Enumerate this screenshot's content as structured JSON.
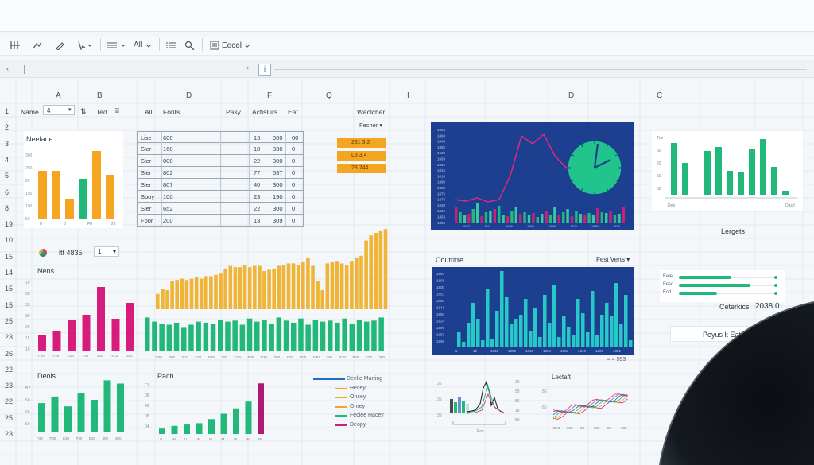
{
  "toolbar": {
    "tool_icons": [
      "grid-icon",
      "draw-icon",
      "pen-icon",
      "cursor-icon"
    ],
    "lines_icon": "lines-icon",
    "font_value": "AlI",
    "list_icon": "list-icon",
    "search_icon": "search-icon",
    "app_label": "Eecel"
  },
  "formula_bar": {
    "fx_label": "i"
  },
  "columns": {
    "a": "A",
    "b": "B",
    "d": "D",
    "f": "F",
    "q": "Q",
    "i": "I",
    "d2": "D",
    "c": "C"
  },
  "rows": [
    "1",
    "2",
    "3",
    "4",
    "5",
    "6",
    "8",
    "19",
    "10",
    "15",
    "14",
    "15",
    "15",
    "25",
    "23",
    "26",
    "22",
    "23",
    "22",
    "25",
    "23"
  ],
  "header_row": {
    "name": "Name",
    "name_val": "4",
    "ted": "Ted",
    "all": "All",
    "fonts": "Fonts",
    "pasy": "Pasy",
    "actions": "Actislurs",
    "eat": "Eat",
    "weather": "Weclcher",
    "fecher": "Fecher"
  },
  "top_left_chart": {
    "title": "Neelane",
    "bars": [
      60,
      60,
      25,
      50,
      85,
      55
    ],
    "colors": [
      "#f4a623",
      "#f4a623",
      "#f4a623",
      "#21b879",
      "#f4a623",
      "#f4a623"
    ],
    "ticks": [
      "8",
      "0",
      "F8",
      "28"
    ]
  },
  "table": {
    "rows": [
      [
        "Lise",
        "600",
        "13",
        "900",
        "00"
      ],
      [
        "Sier",
        "160",
        "18",
        "330",
        "0"
      ],
      [
        "Sier",
        "000",
        "22",
        "300",
        "0"
      ],
      [
        "Sier",
        "802",
        "77",
        "537",
        "0"
      ],
      [
        "Sier",
        "807",
        "40",
        "300",
        "0"
      ],
      [
        "Sboy",
        "100",
        "23",
        "190",
        "0"
      ],
      [
        "Sier",
        "652",
        "22",
        "300",
        "0"
      ],
      [
        "Foor",
        "200",
        "13",
        "309",
        "0"
      ]
    ]
  },
  "tags": [
    "231 3.2",
    "L8 3.4",
    "23 744"
  ],
  "blue_top_chart": {
    "line": [
      30,
      28,
      32,
      27,
      30,
      60,
      110,
      100,
      112,
      85,
      70,
      80,
      75
    ],
    "bars": [
      20,
      14,
      10,
      12,
      18,
      25,
      9,
      14,
      15,
      18,
      22,
      10,
      9,
      16,
      20,
      12,
      14,
      10,
      13,
      8,
      12,
      15,
      10,
      20,
      11,
      14,
      18,
      9,
      15,
      12,
      10,
      13,
      11,
      19,
      14,
      13,
      16,
      10,
      12,
      20
    ],
    "ylabels": [
      "1863",
      "1860",
      "1848",
      "1885",
      "1633",
      "1683",
      "1832",
      "1815",
      "1815",
      "1860",
      "1888",
      "1875",
      "1873",
      "1830",
      "1865",
      "1853",
      "1889"
    ],
    "xlabels": [
      "1832",
      "1821",
      "1888",
      "1896",
      "1898",
      "1825",
      "1880",
      "1875"
    ]
  },
  "right_small_chart": {
    "ylabels": [
      "Tus",
      "50",
      "20",
      "50",
      "50"
    ],
    "xlabels": [
      "Deb",
      "Dasd"
    ],
    "bars": [
      65,
      40,
      0,
      55,
      60,
      30,
      28,
      58,
      70,
      35,
      5
    ],
    "label": "Lergets"
  },
  "widget": {
    "icon": "chrome-like-icon",
    "value": "ltt 4835",
    "dropdown": "1"
  },
  "pink_chart": {
    "title": "Nens",
    "bars": [
      20,
      25,
      38,
      45,
      80,
      40,
      60
    ],
    "ticks": [
      "F20",
      "F30",
      "E20",
      "F38",
      "300",
      "FL0",
      "300"
    ]
  },
  "middle_chart": {
    "orange_bars": [
      12,
      16,
      15,
      22,
      23,
      24,
      23,
      24,
      25,
      24,
      26,
      26,
      27,
      28,
      32,
      34,
      33,
      33,
      35,
      33,
      34,
      34,
      30,
      31,
      32,
      34,
      35,
      36,
      36,
      35,
      37,
      40,
      34,
      22,
      15,
      36,
      37,
      38,
      36,
      35,
      38,
      40,
      42,
      54,
      58,
      60,
      62,
      63
    ],
    "green_bars": [
      32,
      28,
      26,
      25,
      27,
      22,
      25,
      28,
      27,
      26,
      30,
      28,
      29,
      25,
      31,
      28,
      30,
      26,
      32,
      29,
      27,
      31,
      25,
      30,
      28,
      29,
      27,
      31,
      26,
      30,
      28,
      29,
      32
    ],
    "ticks": [
      "F30",
      "300",
      "E10",
      "F30",
      "F30",
      "300",
      "E30",
      "F30",
      "F30",
      "300",
      "E20",
      "F30",
      "F30",
      "300",
      "E30",
      "F30",
      "F30",
      "300"
    ]
  },
  "countries": {
    "title": "Coutrirre",
    "dropdown": "Fest Verts",
    "bars": [
      18,
      6,
      30,
      55,
      35,
      8,
      72,
      10,
      45,
      95,
      62,
      28,
      35,
      40,
      60,
      20,
      48,
      12,
      65,
      30,
      78,
      12,
      38,
      25,
      15,
      60,
      42,
      18,
      70,
      15,
      40,
      55,
      38,
      80,
      28,
      65,
      8
    ],
    "ylabels": [
      "1860",
      "1866",
      "1800",
      "1853",
      "1850",
      "1843",
      "1850",
      "1824",
      "1896",
      "1850",
      "1895"
    ],
    "xlabels": [
      "5",
      "12",
      "1830",
      "1800",
      "1810",
      "1804",
      "1883",
      "1810",
      "1300",
      "1301"
    ],
    "footer": "≈ ≈ 593"
  },
  "progress": {
    "items": [
      {
        "label": "Eeie",
        "value": 0.55
      },
      {
        "label": "Fesd",
        "value": 0.75
      },
      {
        "label": "Fod",
        "value": 0.4
      }
    ],
    "footer_label": "Ceterkics",
    "footer_value": "2038.0",
    "link": "Peyus k Eat"
  },
  "dools_chart": {
    "title": "Deols",
    "bars": [
      45,
      55,
      40,
      60,
      50,
      80,
      75
    ],
    "ticks": [
      "F30",
      "F30",
      "E30",
      "F30",
      "E30",
      "300",
      "300"
    ],
    "ylabels": [
      "B2",
      "50",
      "60",
      "50"
    ]
  },
  "path_chart": {
    "title": "Pach",
    "bars": [
      8,
      12,
      14,
      16,
      22,
      30,
      38,
      48,
      75
    ],
    "ticks": [
      "V",
      "W",
      "V",
      "W",
      "M",
      "M",
      "W",
      "W",
      "W"
    ],
    "ylabels": [
      "C8",
      "08",
      "48",
      "08",
      "04"
    ]
  },
  "legend": {
    "items": [
      {
        "label": "Deelie Marting",
        "color": "#1a6fbf"
      },
      {
        "label": "Hecey",
        "color": "#f4a623"
      },
      {
        "label": "Onsey",
        "color": "#f4a623"
      },
      {
        "label": "Onrey",
        "color": "#f4a623"
      },
      {
        "label": "Feclee Hacey",
        "color": "#21b879"
      },
      {
        "label": "Deopy",
        "color": "#cc1f7a"
      }
    ]
  },
  "mini_line_chart": {
    "yticks": [
      "35",
      "35",
      "35"
    ],
    "rticks": [
      "30",
      "58",
      "56",
      "18",
      "50"
    ],
    "xlabel": "Pos"
  },
  "lectaft": {
    "title": "Lectaft",
    "ylabels": [
      "8E",
      "60"
    ],
    "xlabels": [
      "De8",
      "380",
      "28",
      "380",
      "28",
      "380"
    ]
  }
}
